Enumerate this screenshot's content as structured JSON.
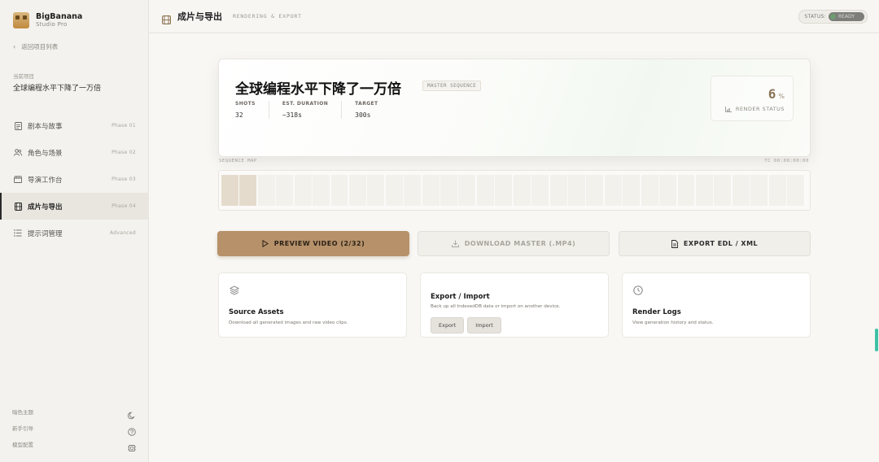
{
  "brand": {
    "name": "BigBanana",
    "subtitle": "Studio Pro"
  },
  "sidebar": {
    "back_label": "返回项目列表",
    "project_label": "当前项目",
    "project_name": "全球编程水平下降了一万倍",
    "items": [
      {
        "label": "剧本与故事",
        "phase": "Phase 01",
        "icon": "document-icon"
      },
      {
        "label": "角色与场景",
        "phase": "Phase 02",
        "icon": "users-icon"
      },
      {
        "label": "导演工作台",
        "phase": "Phase 03",
        "icon": "clapperboard-icon"
      },
      {
        "label": "成片与导出",
        "phase": "Phase 04",
        "icon": "film-icon",
        "active": true
      },
      {
        "label": "提示词管理",
        "phase": "Advanced",
        "icon": "list-icon"
      }
    ],
    "footer": [
      {
        "label": "暗色主题",
        "icon": "moon-icon"
      },
      {
        "label": "新手引导",
        "icon": "help-icon"
      },
      {
        "label": "模型配置",
        "icon": "chip-icon"
      }
    ]
  },
  "header": {
    "title": "成片与导出",
    "subtitle": "RENDERING & EXPORT",
    "status_label": "STATUS:",
    "status_value": "READY"
  },
  "hero": {
    "title": "全球编程水平下降了一万倍",
    "badge": "MASTER SEQUENCE",
    "stats": [
      {
        "label": "SHOTS",
        "value": "32"
      },
      {
        "label": "EST. DURATION",
        "value": "~318s"
      },
      {
        "label": "TARGET",
        "value": "300s"
      }
    ],
    "render_value": "6",
    "render_unit": "%",
    "render_label": "RENDER STATUS"
  },
  "sequence": {
    "label": "SEQUENCE MAP",
    "timecode": "TC 00:00:00:00",
    "shot_count": 32,
    "filled_count": 2
  },
  "actions": {
    "preview": "PREVIEW VIDEO (2/32)",
    "download": "DOWNLOAD MASTER (.MP4)",
    "export": "EXPORT EDL / XML"
  },
  "cards": {
    "source": {
      "title": "Source Assets",
      "desc": "Download all generated images and raw video clips."
    },
    "export_import": {
      "title": "Export / Import",
      "desc": "Back up all IndexedDB data or import on another device.",
      "export_btn": "Export",
      "import_btn": "Import"
    },
    "logs": {
      "title": "Render Logs",
      "desc": "View generation history and status."
    }
  },
  "colors": {
    "accent": "#b6916a",
    "render_value": "#8a7356",
    "active_bar": "#2a2a2a"
  }
}
